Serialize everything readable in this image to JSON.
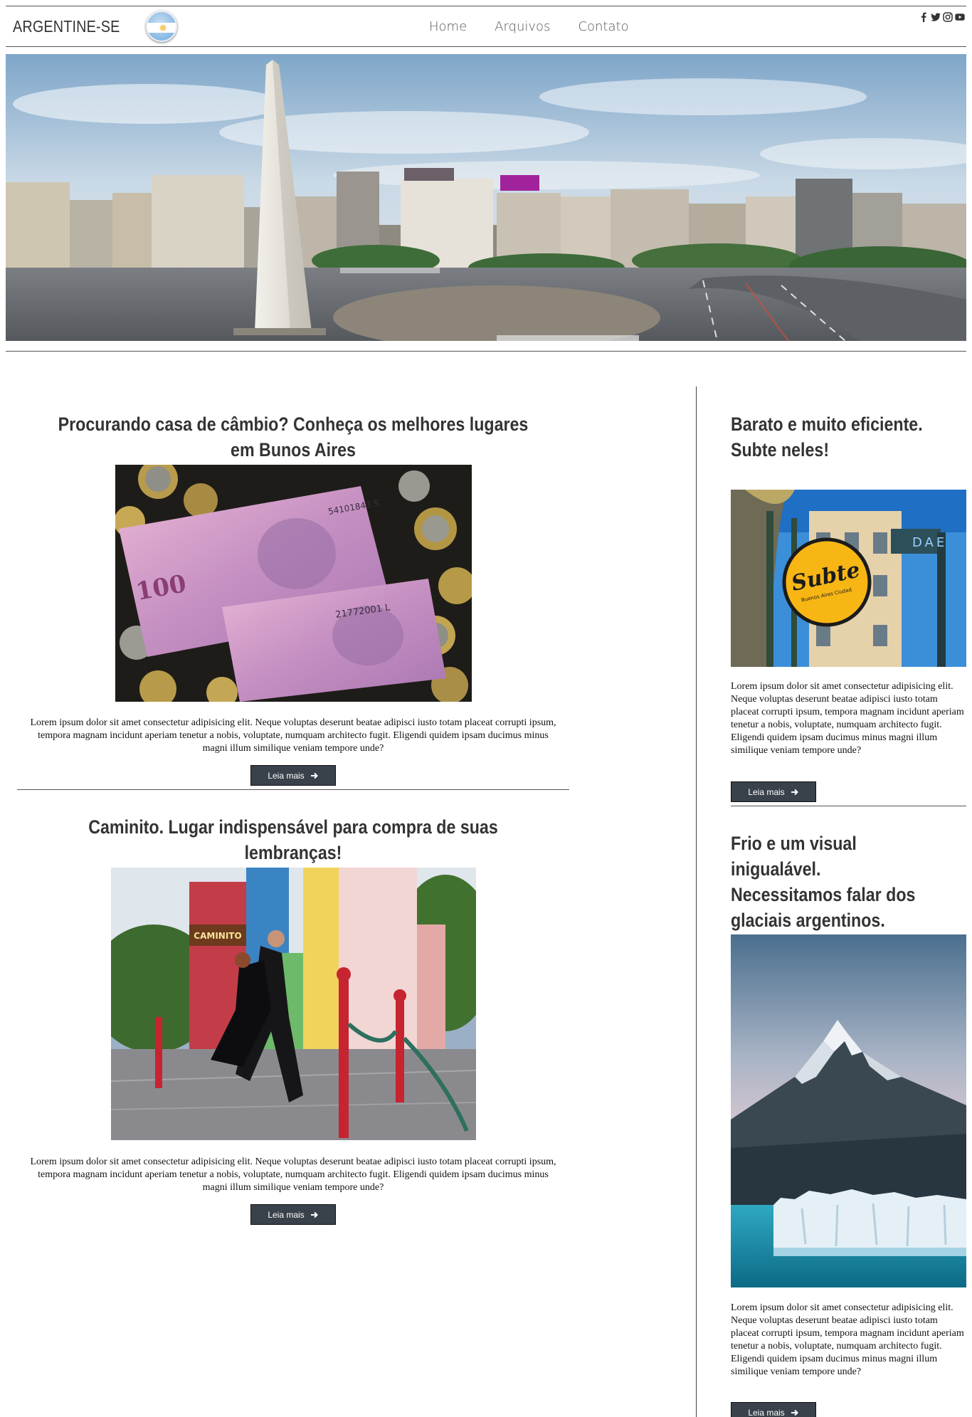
{
  "header": {
    "brand": "ARGENTINE-SE",
    "nav": [
      "Home",
      "Arquivos",
      "Contato"
    ]
  },
  "main_posts": [
    {
      "title": "Procurando casa de câmbio? Conheça os melhores lugares em Bunos Aires",
      "excerpt": "Lorem ipsum dolor sit amet consectetur adipisicing elit. Neque voluptas deserunt beatae adipisci iusto totam placeat corrupti ipsum, tempora magnam incidunt aperiam tenetur a nobis, voluptate, numquam architecto fugit. Eligendi quidem ipsam ducimus minus magni illum similique veniam tempore unde?",
      "button": "Leia mais"
    },
    {
      "title": "Caminito. Lugar indispensável para compra de suas lembranças!",
      "excerpt": "Lorem ipsum dolor sit amet consectetur adipisicing elit. Neque voluptas deserunt beatae adipisci iusto totam placeat corrupti ipsum, tempora magnam incidunt aperiam tenetur a nobis, voluptate, numquam architecto fugit. Eligendi quidem ipsam ducimus minus magni illum similique veniam tempore unde?",
      "button": "Leia mais"
    }
  ],
  "side_posts": [
    {
      "title": "Barato e muito eficiente. Subte neles!",
      "excerpt": "Lorem ipsum dolor sit amet consectetur adipisicing elit. Neque voluptas deserunt beatae adipisci iusto totam placeat corrupti ipsum, tempora magnam incidunt aperiam tenetur a nobis, voluptate, numquam architecto fugit. Eligendi quidem ipsam ducimus minus magni illum similique veniam tempore unde?",
      "button": "Leia mais"
    },
    {
      "title": "Frio e um visual inigualável. Necessitamos falar dos glaciais argentinos.",
      "excerpt": "Lorem ipsum dolor sit amet consectetur adipisicing elit. Neque voluptas deserunt beatae adipisci iusto totam placeat corrupti ipsum, tempora magnam incidunt aperiam tenetur a nobis, voluptate, numquam architecto fugit. Eligendi quidem ipsam ducimus minus magni illum similique veniam tempore unde?",
      "button": "Leia mais"
    }
  ],
  "subte_sign": {
    "logo": "Subte",
    "tagline": "Buenos Aires Ciudad",
    "lines": "DAE"
  },
  "caminito_sign": "CAMINITO",
  "icons": [
    "facebook-icon",
    "twitter-icon",
    "instagram-icon",
    "youtube-icon",
    "arrow-right-icon"
  ],
  "colors": {
    "button_bg": "#39424b",
    "title_text": "#333333",
    "nav_text": "#555555"
  }
}
